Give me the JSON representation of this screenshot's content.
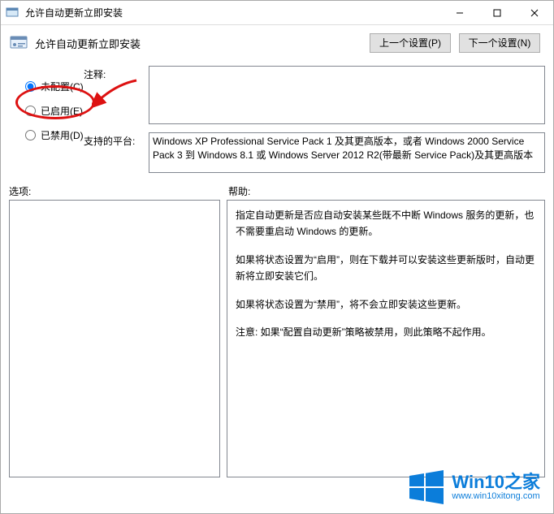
{
  "window": {
    "title": "允许自动更新立即安装"
  },
  "header": {
    "title": "允许自动更新立即安装",
    "prev_btn": "上一个设置(P)",
    "next_btn": "下一个设置(N)"
  },
  "radios": {
    "not_configured": "未配置(C)",
    "enabled": "已启用(E)",
    "disabled": "已禁用(D)",
    "selected": "not_configured"
  },
  "fields": {
    "comment_label": "注释:",
    "comment_value": "",
    "platform_label": "支持的平台:",
    "platform_text": "Windows XP Professional Service Pack 1 及其更高版本，或者 Windows 2000 Service Pack 3 到 Windows 8.1 或 Windows Server 2012 R2(带最新 Service Pack)及其更高版本"
  },
  "panes": {
    "options_label": "选项:",
    "help_label": "帮助:",
    "help_p1": "指定自动更新是否应自动安装某些既不中断 Windows 服务的更新，也不需要重启动 Windows 的更新。",
    "help_p2": "如果将状态设置为“启用”，则在下载并可以安装这些更新版时，自动更新将立即安装它们。",
    "help_p3": "如果将状态设置为“禁用”，将不会立即安装这些更新。",
    "help_p4": "注意: 如果“配置自动更新”策略被禁用，则此策略不起作用。"
  },
  "watermark": {
    "big": "Win10之家",
    "url": "www.win10xitong.com"
  }
}
